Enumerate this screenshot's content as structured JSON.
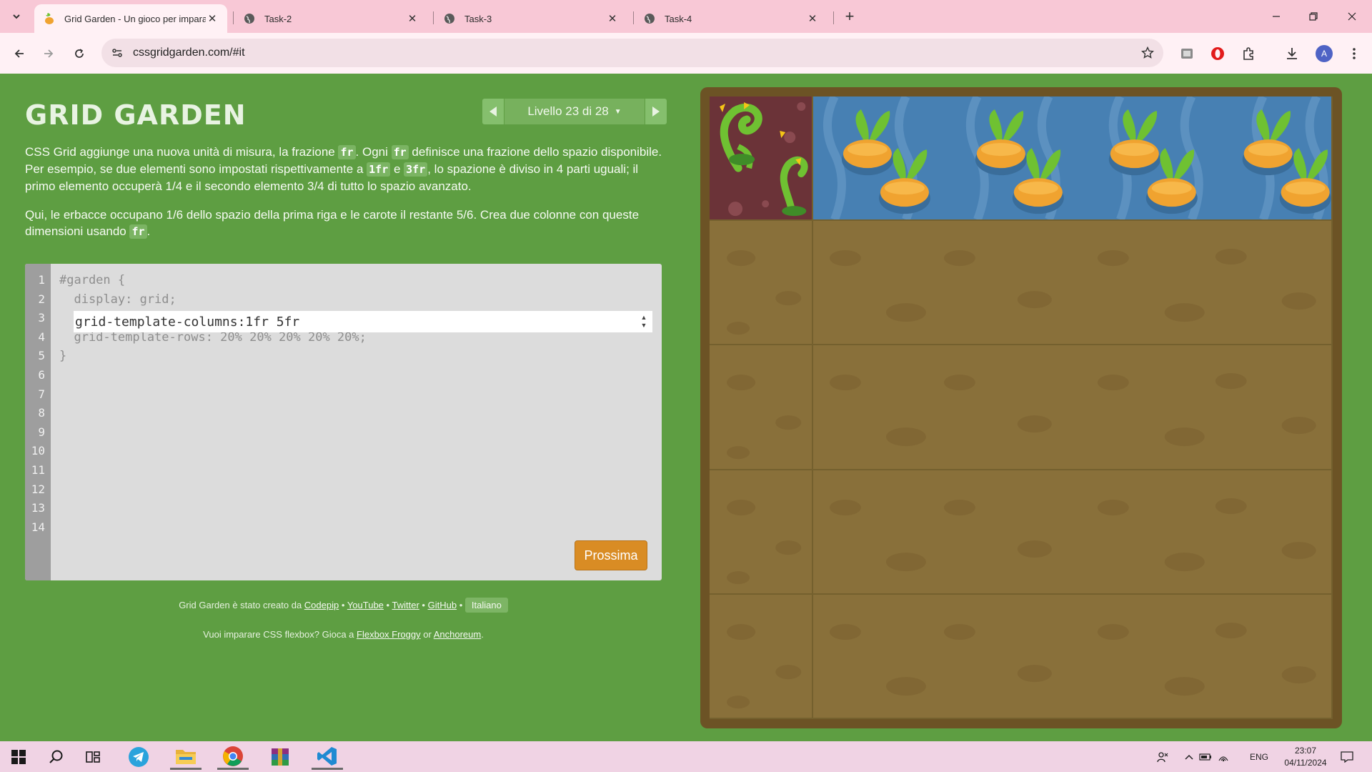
{
  "browser": {
    "tabs": [
      {
        "title": "Grid Garden - Un gioco per imparare",
        "active": true
      },
      {
        "title": "Task-2",
        "active": false
      },
      {
        "title": "Task-3",
        "active": false
      },
      {
        "title": "Task-4",
        "active": false
      }
    ],
    "close_glyph": "✕",
    "new_tab_glyph": "+",
    "url": "cssgridgarden.com/#it",
    "profile_initial": "A"
  },
  "page": {
    "logo": "GRID GARDEN",
    "level_label": "Livello 23 di 28",
    "instructions": {
      "p1": {
        "t1": "CSS Grid aggiunge una nuova unità di misura, la frazione ",
        "c1": "fr",
        "t2": ". Ogni ",
        "c2": "fr",
        "t3": " definisce una frazione dello spazio disponibile. Per esempio, se due elementi sono impostati rispettivamente a ",
        "c3": "1fr",
        "t4": " e ",
        "c4": "3fr",
        "t5": ", lo spazione è diviso in 4 parti uguali; il primo elemento occuperà 1/4 e il secondo elemento 3/4 di tutto lo spazio avanzato."
      },
      "p2": {
        "t1": "Qui, le erbacce occupano 1/6 dello spazio della prima riga e le carote il restante 5/6. Crea due colonne con queste dimensioni usando ",
        "c1": "fr",
        "t2": "."
      }
    },
    "editor": {
      "line_numbers": [
        "1",
        "2",
        "3",
        "4",
        "5",
        "6",
        "7",
        "8",
        "9",
        "10",
        "11",
        "12",
        "13",
        "14"
      ],
      "code_lines": [
        "#garden {",
        "  display: grid;",
        "",
        "  grid-template-rows: 20% 20% 20% 20% 20%;",
        "}"
      ],
      "input_value": "grid-template-columns:1fr 5fr",
      "next_button": "Prossima"
    },
    "footer": {
      "credit_prefix": "Grid Garden è stato creato da",
      "links": [
        "Codepip",
        "YouTube",
        "Twitter",
        "GitHub"
      ],
      "separator": "•",
      "language": "Italiano",
      "promo_prefix": "Vuoi imparare CSS flexbox? Gioca a",
      "promo_link1": "Flexbox Froggy",
      "promo_or": "or",
      "promo_link2": "Anchoreum",
      "promo_suffix": "."
    },
    "garden": {
      "columns": "1fr 5fr",
      "rows": "20% 20% 20% 20% 20%",
      "colors": {
        "soil": "#89703a",
        "water": "#4780b3",
        "weed_bg": "#6b3338",
        "carrot": "#f0a330",
        "leaf": "#6fc132"
      }
    }
  },
  "taskbar": {
    "apps": [
      "windows-start",
      "search",
      "task-view",
      "telegram",
      "file-explorer",
      "chrome",
      "winrar",
      "vscode"
    ],
    "language": "ENG",
    "time": "23:07",
    "date": "04/11/2024"
  }
}
